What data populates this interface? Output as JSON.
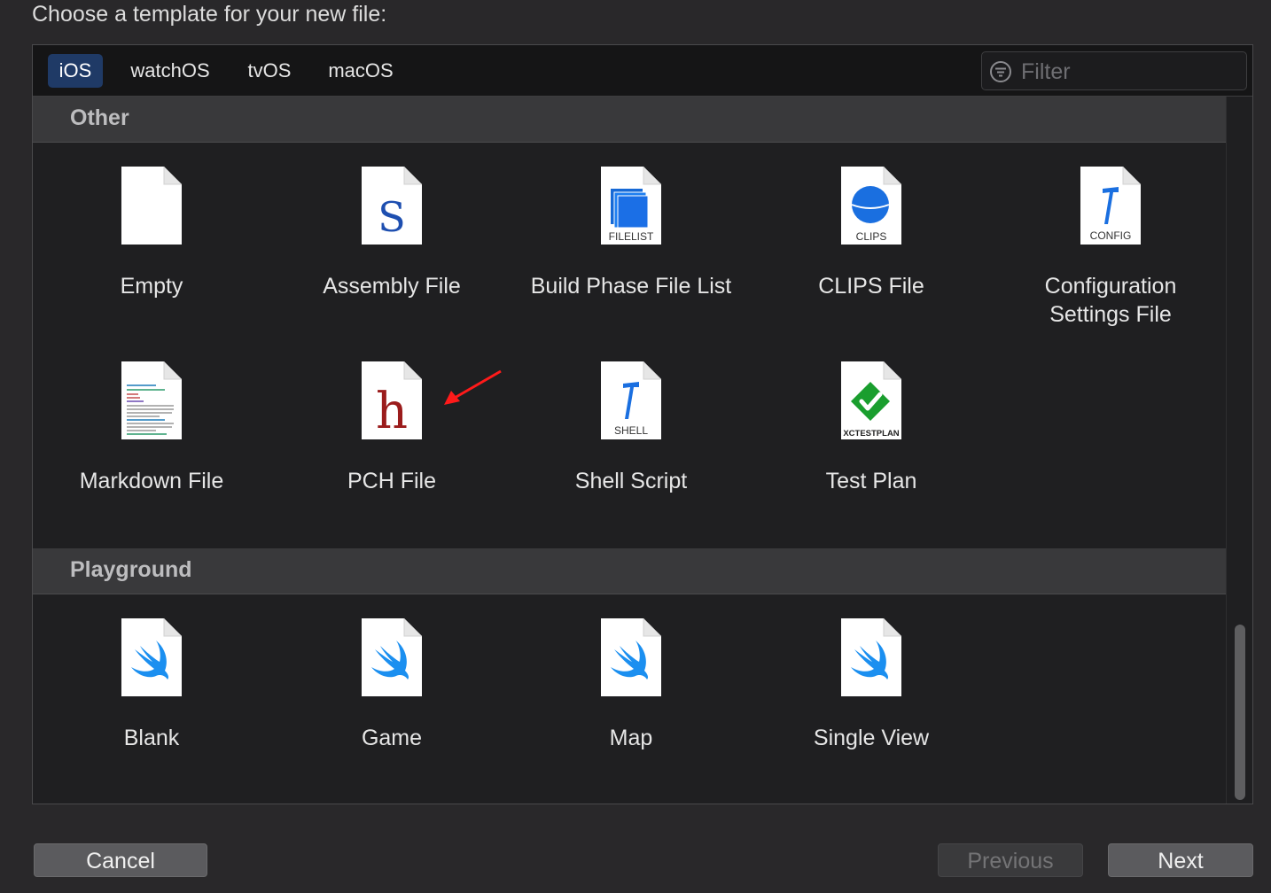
{
  "dialog": {
    "title": "Choose a template for your new file:"
  },
  "tabs": [
    {
      "label": "iOS",
      "active": true
    },
    {
      "label": "watchOS",
      "active": false
    },
    {
      "label": "tvOS",
      "active": false
    },
    {
      "label": "macOS",
      "active": false
    }
  ],
  "filter": {
    "placeholder": "Filter",
    "icon": "filter-icon"
  },
  "sections": [
    {
      "title": "Other",
      "items": [
        {
          "label": "Empty",
          "icon": "empty-file-icon"
        },
        {
          "label": "Assembly File",
          "icon": "assembly-file-icon",
          "glyph": "S"
        },
        {
          "label": "Build Phase File List",
          "icon": "filelist-icon",
          "badge": "FILELIST"
        },
        {
          "label": "CLIPS File",
          "icon": "clips-icon",
          "badge": "CLIPS"
        },
        {
          "label": "Configuration Settings File",
          "icon": "config-icon",
          "badge": "CONFIG"
        },
        {
          "label": "Markdown File",
          "icon": "markdown-icon"
        },
        {
          "label": "PCH File",
          "icon": "pch-icon",
          "glyph": "h"
        },
        {
          "label": "Shell Script",
          "icon": "shell-icon",
          "badge": "SHELL"
        },
        {
          "label": "Test Plan",
          "icon": "testplan-icon",
          "badge": "XCTESTPLAN"
        }
      ]
    },
    {
      "title": "Playground",
      "items": [
        {
          "label": "Blank",
          "icon": "swift-icon"
        },
        {
          "label": "Game",
          "icon": "swift-icon"
        },
        {
          "label": "Map",
          "icon": "swift-icon"
        },
        {
          "label": "Single View",
          "icon": "swift-icon"
        }
      ]
    }
  ],
  "buttons": {
    "cancel": "Cancel",
    "previous": "Previous",
    "next": "Next"
  },
  "colors": {
    "accent_tab": "#1f3a66",
    "swift": "#1b8ff0",
    "pch_red": "#9b1c1c",
    "test_green": "#1a9e2e",
    "annotation_arrow": "#ff1a1a"
  }
}
